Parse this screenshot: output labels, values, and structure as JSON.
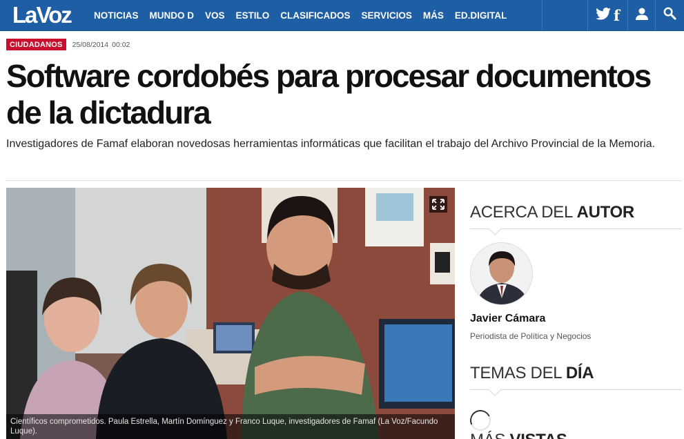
{
  "brand": {
    "logo_text": "LaVoz",
    "nav_color": "#1d5ea5",
    "accent": "#c8102e"
  },
  "nav": {
    "items": [
      "NOTICIAS",
      "MUNDO D",
      "VOS",
      "ESTILO",
      "CLASIFICADOS",
      "SERVICIOS",
      "MÁS",
      "ED.DIGITAL"
    ],
    "icons": [
      "twitter-icon",
      "facebook-icon",
      "user-icon",
      "search-icon"
    ],
    "facebook_glyph": "f"
  },
  "article": {
    "section": "CIUDADANOS",
    "date": "25/08/2014",
    "time": "00:02",
    "headline": "Software cordobés para procesar documentos de la dictadura",
    "subtitle": "Investigadores de Famaf elaboran novedosas herramientas informáticas que facilitan el trabajo del Archivo Provincial de la Memoria.",
    "photo_caption": "Científicos comprometidos. Paula Estrella, Martín Domínguez y Franco Luque, investigadores de Famaf (La Voz/Facundo Luque)."
  },
  "sidebar": {
    "about_author": {
      "light": "ACERCA DEL ",
      "bold": "AUTOR"
    },
    "author": {
      "name": "Javier Cámara",
      "role": "Periodista de Política y Negocios"
    },
    "topics": {
      "light": "TEMAS DEL ",
      "bold": "DÍA"
    },
    "most_viewed": {
      "light": "MÁS ",
      "bold": "VISTAS"
    }
  }
}
